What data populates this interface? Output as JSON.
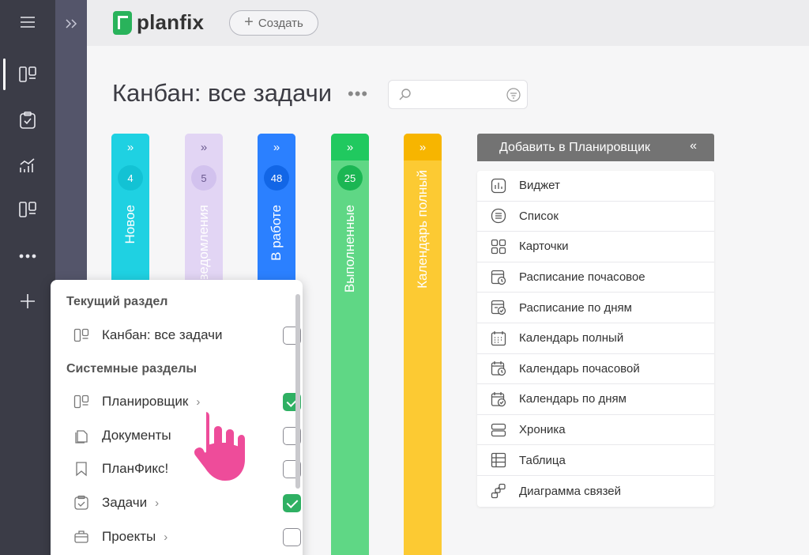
{
  "app": {
    "logo_text": "planfix",
    "create_label": "Создать"
  },
  "sidebar": {
    "items": [
      {
        "icon": "menu-icon"
      },
      {
        "icon": "planner-icon",
        "active": true
      },
      {
        "icon": "tasks-icon"
      },
      {
        "icon": "analytics-icon"
      },
      {
        "icon": "planner-icon"
      },
      {
        "icon": "more-icon"
      },
      {
        "icon": "plus-icon"
      }
    ]
  },
  "page": {
    "title": "Канбан: все задачи",
    "search_placeholder": ""
  },
  "columns": [
    {
      "label": "Новое",
      "count": "4",
      "head_color": "#1fd1e2",
      "body_color": "#1fd1e2",
      "badge_color": "#13c2d4"
    },
    {
      "label": "Уведомления",
      "count": "5",
      "head_color": "#e2d5f4",
      "body_color": "#e2d5f4",
      "badge_color": "#d2c2ee"
    },
    {
      "label": "В работе",
      "count": "48",
      "head_color": "#2b80ff",
      "body_color": "#2b80ff",
      "badge_color": "#1266e6"
    },
    {
      "label": "Выполненные",
      "count": "25",
      "head_color": "#20c95f",
      "body_color": "#5fd785",
      "badge_color": "#1bb653"
    },
    {
      "label": "Календарь полный",
      "count": "",
      "head_color": "#f7b500",
      "body_color": "#fcca33",
      "badge_color": ""
    }
  ],
  "planner": {
    "header": "Добавить в Планировщик",
    "items": [
      {
        "label": "Виджет",
        "icon": "widget-icon"
      },
      {
        "label": "Список",
        "icon": "list-icon"
      },
      {
        "label": "Карточки",
        "icon": "cards-icon"
      },
      {
        "label": "Расписание почасовое",
        "icon": "schedule-hourly-icon"
      },
      {
        "label": "Расписание по дням",
        "icon": "schedule-daily-icon"
      },
      {
        "label": "Календарь полный",
        "icon": "calendar-full-icon"
      },
      {
        "label": "Календарь почасовой",
        "icon": "calendar-hourly-icon"
      },
      {
        "label": "Календарь по дням",
        "icon": "calendar-daily-icon"
      },
      {
        "label": "Хроника",
        "icon": "chronicle-icon"
      },
      {
        "label": "Таблица",
        "icon": "table-icon"
      },
      {
        "label": "Диаграмма связей",
        "icon": "diagram-icon"
      }
    ]
  },
  "popup": {
    "current_section_title": "Текущий раздел",
    "system_section_title": "Системные разделы",
    "current_items": [
      {
        "label": "Канбан: все задачи",
        "icon": "planner-icon",
        "checked": false,
        "has_chevron": false
      }
    ],
    "system_items": [
      {
        "label": "Планировщик",
        "icon": "planner-icon",
        "checked": true,
        "has_chevron": true
      },
      {
        "label": "Документы",
        "icon": "documents-icon",
        "checked": false,
        "has_chevron": false
      },
      {
        "label": "ПланФикс!",
        "icon": "bookmark-icon",
        "checked": false,
        "has_chevron": false
      },
      {
        "label": "Задачи",
        "icon": "tasks-icon",
        "checked": true,
        "has_chevron": true
      },
      {
        "label": "Проекты",
        "icon": "projects-icon",
        "checked": false,
        "has_chevron": true
      }
    ]
  }
}
